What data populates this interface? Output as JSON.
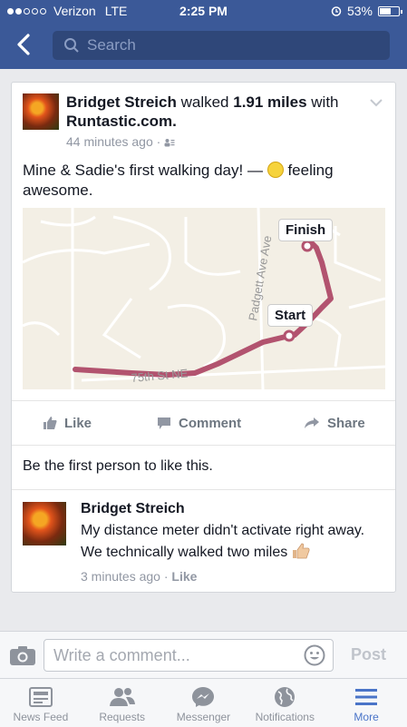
{
  "status": {
    "carrier": "Verizon",
    "network": "LTE",
    "time": "2:25 PM",
    "battery": "53%"
  },
  "nav": {
    "search_placeholder": "Search"
  },
  "post": {
    "author": "Bridget Streich",
    "verb": "walked",
    "distance": "1.91 miles",
    "with_text": "with",
    "app": "Runtastic.com.",
    "time": "44 minutes ago",
    "text_before": "Mine & Sadie's first walking day! —",
    "feeling": "feeling awesome."
  },
  "map": {
    "finish_label": "Finish",
    "start_label": "Start",
    "street_1": "Padgett Ave Ave",
    "street_2": "75th St NE",
    "route_color": "#b2536f"
  },
  "actions": {
    "like": "Like",
    "comment": "Comment",
    "share": "Share"
  },
  "likes_text": "Be the first person to like this.",
  "comment": {
    "author": "Bridget Streich",
    "text": "My distance meter didn't activate right away. We technically walked two miles",
    "time": "3 minutes ago",
    "like": "Like"
  },
  "composer": {
    "placeholder": "Write a comment...",
    "post": "Post"
  },
  "tabs": [
    {
      "label": "News Feed",
      "icon": "news-feed-icon"
    },
    {
      "label": "Requests",
      "icon": "requests-icon"
    },
    {
      "label": "Messenger",
      "icon": "messenger-icon"
    },
    {
      "label": "Notifications",
      "icon": "globe-icon"
    },
    {
      "label": "More",
      "icon": "menu-icon"
    }
  ],
  "colors": {
    "brand": "#3b5998",
    "active_tab": "#4a74c8"
  }
}
